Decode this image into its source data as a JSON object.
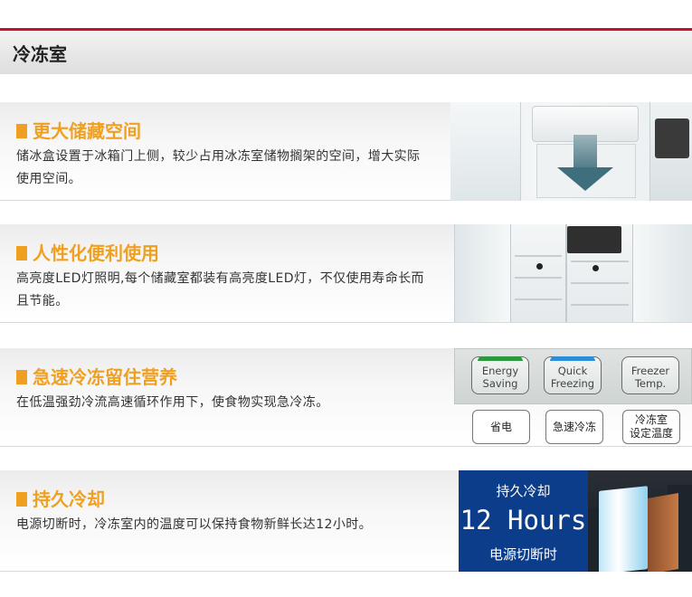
{
  "header": {
    "title": "冷冻室"
  },
  "sections": [
    {
      "title": "更大储藏空间",
      "desc": "储冰盒设置于冰箱门上侧，较少占用冰冻室储物搁架的空间，增大实际使用空间。"
    },
    {
      "title": "人性化便利使用",
      "desc": "高亮度LED灯照明,每个储藏室都装有高亮度LED灯，不仅使用寿命长而且节能。"
    },
    {
      "title": "急速冷冻留住营养",
      "desc": "在低温强劲冷流高速循环作用下，使食物实现急冷冻。"
    },
    {
      "title": "持久冷却",
      "desc": "电源切断时，冷冻室内的温度可以保持食物新鲜长达12小时。"
    }
  ],
  "control_panel": {
    "buttons_en": [
      {
        "line1": "Energy",
        "line2": "Saving"
      },
      {
        "line1": "Quick",
        "line2": "Freezing"
      },
      {
        "line1": "Freezer",
        "line2": "Temp."
      }
    ],
    "buttons_cn": [
      {
        "line1": "省电",
        "line2": ""
      },
      {
        "line1": "急速冷冻",
        "line2": ""
      },
      {
        "line1": "冷冻室",
        "line2": "设定温度"
      }
    ]
  },
  "hours_banner": {
    "top": "持久冷却",
    "big": "12 Hours",
    "bottom": "电源切断时"
  },
  "colors": {
    "accent": "#f0a020",
    "top_line": "#c8102e",
    "banner_blue": "#0c3d8a"
  }
}
